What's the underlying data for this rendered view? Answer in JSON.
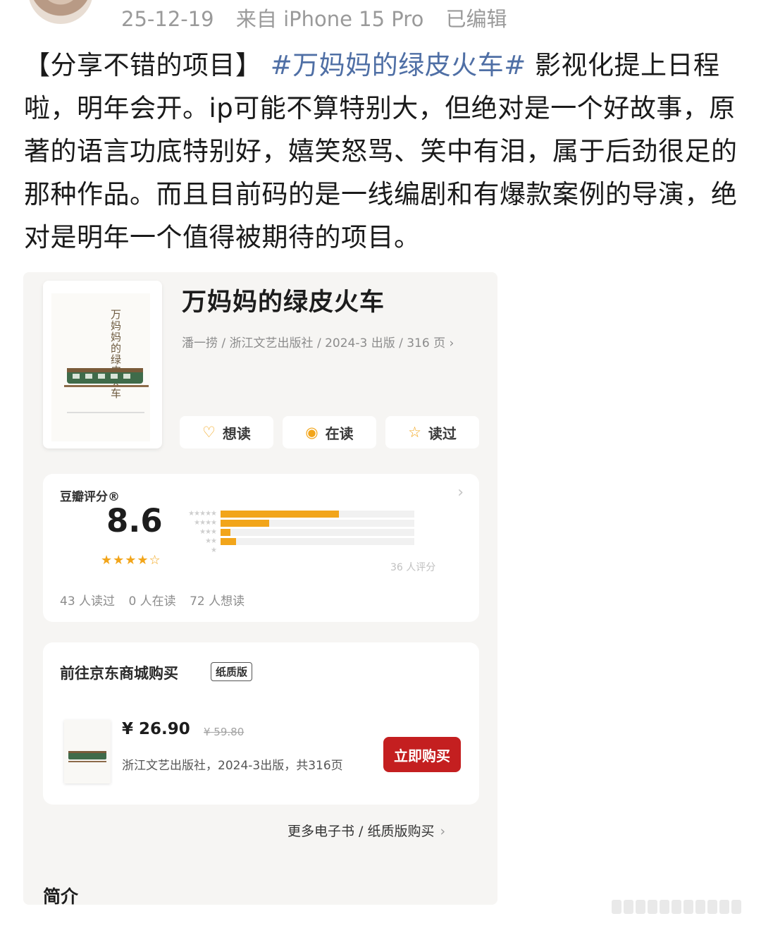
{
  "post_meta": {
    "date": "25-12-19",
    "source": "来自 iPhone 15 Pro",
    "edited": "已编辑"
  },
  "post": {
    "text_before": "【分享不错的项目】 ",
    "hashtag": "#万妈妈的绿皮火车#",
    "text_after": " 影视化提上日程啦，明年会开。ip可能不算特别大，但绝对是一个好故事，原著的语言功底特别好，嬉笑怒骂、笑中有泪，属于后劲很足的那种作品。而且目前码的是一线编剧和有爆款案例的导演，绝对是明年一个值得被期待的项目。"
  },
  "book": {
    "title": "万妈妈的绿皮火车",
    "meta": "潘一捞 / 浙江文艺出版社 / 2024-3 出版 / 316 页",
    "cover_vertical_title": "万妈妈的绿皮火车",
    "actions": [
      {
        "label": "想读",
        "icon": "heart-plus-icon"
      },
      {
        "label": "在读",
        "icon": "reading-icon"
      },
      {
        "label": "读过",
        "icon": "star-icon"
      }
    ]
  },
  "rating": {
    "label": "豆瓣评分®",
    "score": "8.6",
    "stars_text": "★★★★☆",
    "distribution": [
      {
        "stars": "★★★★★",
        "fraction": 0.61
      },
      {
        "stars": "★★★★",
        "fraction": 0.25
      },
      {
        "stars": "★★★",
        "fraction": 0.05
      },
      {
        "stars": "★★",
        "fraction": 0.08
      },
      {
        "stars": "★",
        "fraction": 0.0
      }
    ],
    "count": "36 人评分",
    "stats": [
      "43 人读过",
      "0 人在读",
      "72 人想读"
    ]
  },
  "purchase": {
    "heading": "前往京东商城购买",
    "edition_tag": "纸质版",
    "price": "¥ 26.90",
    "original_price": "¥ 59.80",
    "publisher_line": "浙江文艺出版社，2024-3出版，共316页",
    "buy_button": "立即购买",
    "more_link": "更多电子书 / 纸质版购买"
  },
  "intro_heading": "简介",
  "colors": {
    "accent_star": "#f2a51a",
    "hashtag": "#4f6fa5",
    "buy_button": "#c41f20"
  }
}
